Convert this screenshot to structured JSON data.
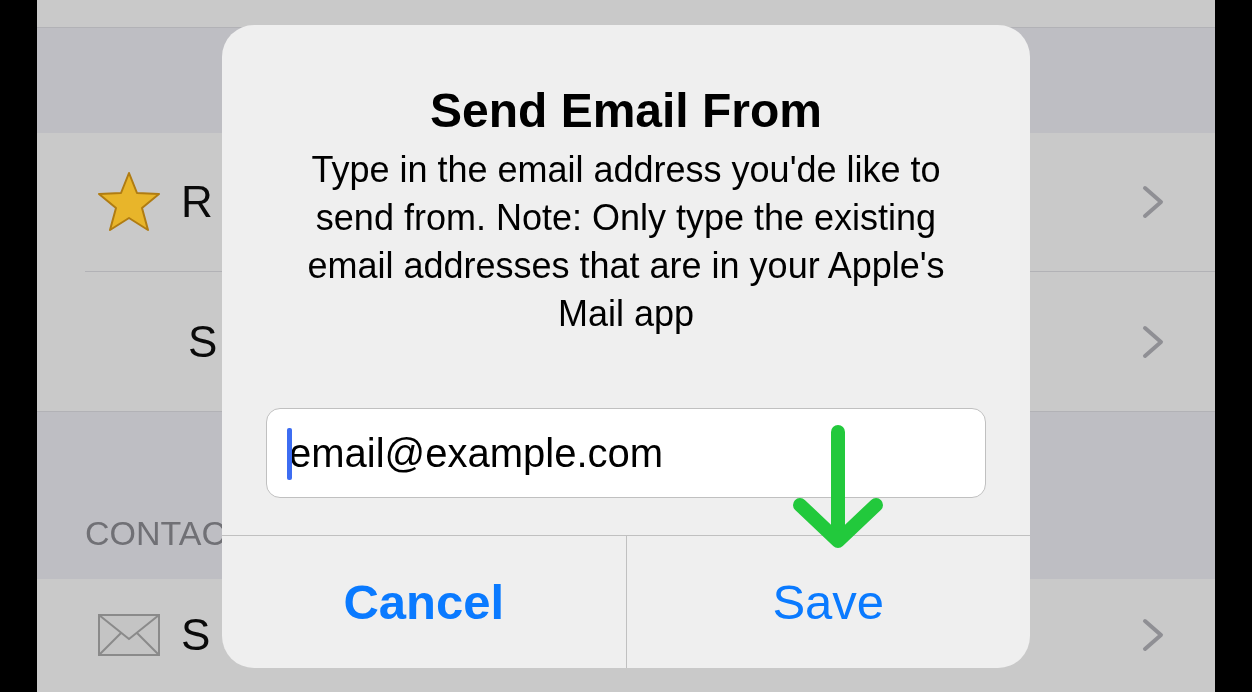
{
  "background_list": {
    "sections": [
      {
        "kind": "group"
      },
      {
        "kind": "row",
        "label": "R",
        "has_icon": true,
        "chevron": true,
        "separator": true
      },
      {
        "kind": "row",
        "label": "S",
        "has_icon": false,
        "chevron": true,
        "separator": false
      },
      {
        "kind": "group",
        "header": "CONTAC"
      },
      {
        "kind": "row",
        "label": "S",
        "has_icon": true,
        "chevron": true,
        "separator": false
      }
    ]
  },
  "dialog": {
    "title": "Send Email From",
    "message": "Type in the email address you'de like to send from. Note: Only type the existing email addresses that are in your Apple's Mail app",
    "field": {
      "value": "email@example.com",
      "focused": true
    },
    "buttons": [
      {
        "label": "Cancel",
        "kind": "cancel"
      },
      {
        "label": "Save",
        "kind": "default"
      }
    ]
  },
  "annotation": {
    "kind": "down_arrow"
  }
}
